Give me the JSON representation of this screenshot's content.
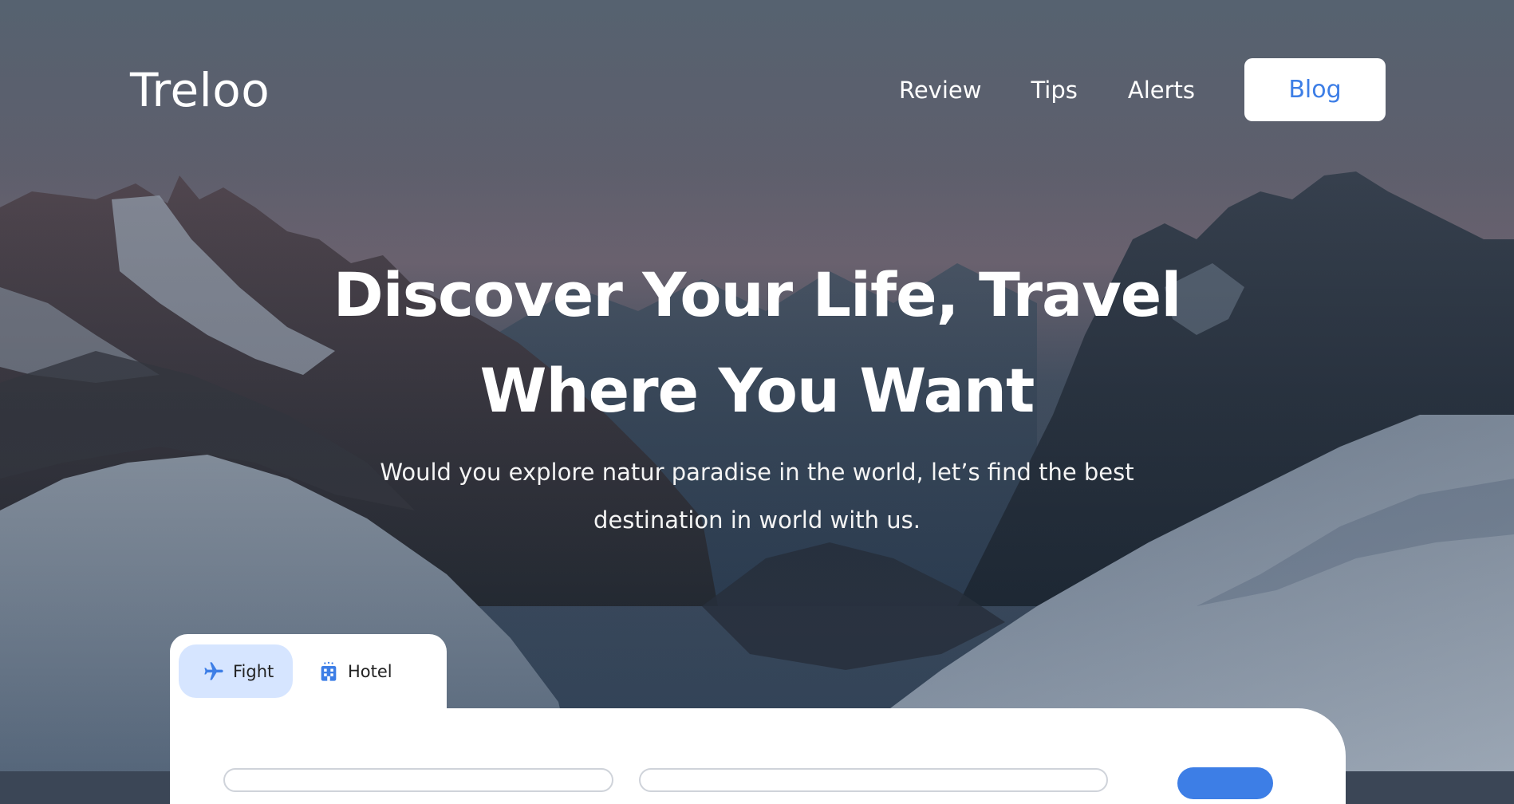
{
  "header": {
    "logo": "Treloo",
    "nav": [
      {
        "label": "Review"
      },
      {
        "label": "Tips"
      },
      {
        "label": "Alerts"
      }
    ],
    "blog_label": "Blog"
  },
  "hero": {
    "headline_line1": "Discover Your Life, Travel",
    "headline_line2": "Where You Want",
    "subhead_line1": "Would you explore natur paradise in the world, let’s find the best",
    "subhead_line2": "destination in world with us."
  },
  "search": {
    "tabs": [
      {
        "label": "Fight",
        "icon": "airplane-icon",
        "active": true
      },
      {
        "label": "Hotel",
        "icon": "hotel-icon",
        "active": false
      }
    ]
  },
  "colors": {
    "accent": "#3d7ee6",
    "active_tab_bg": "#d6e5ff"
  }
}
